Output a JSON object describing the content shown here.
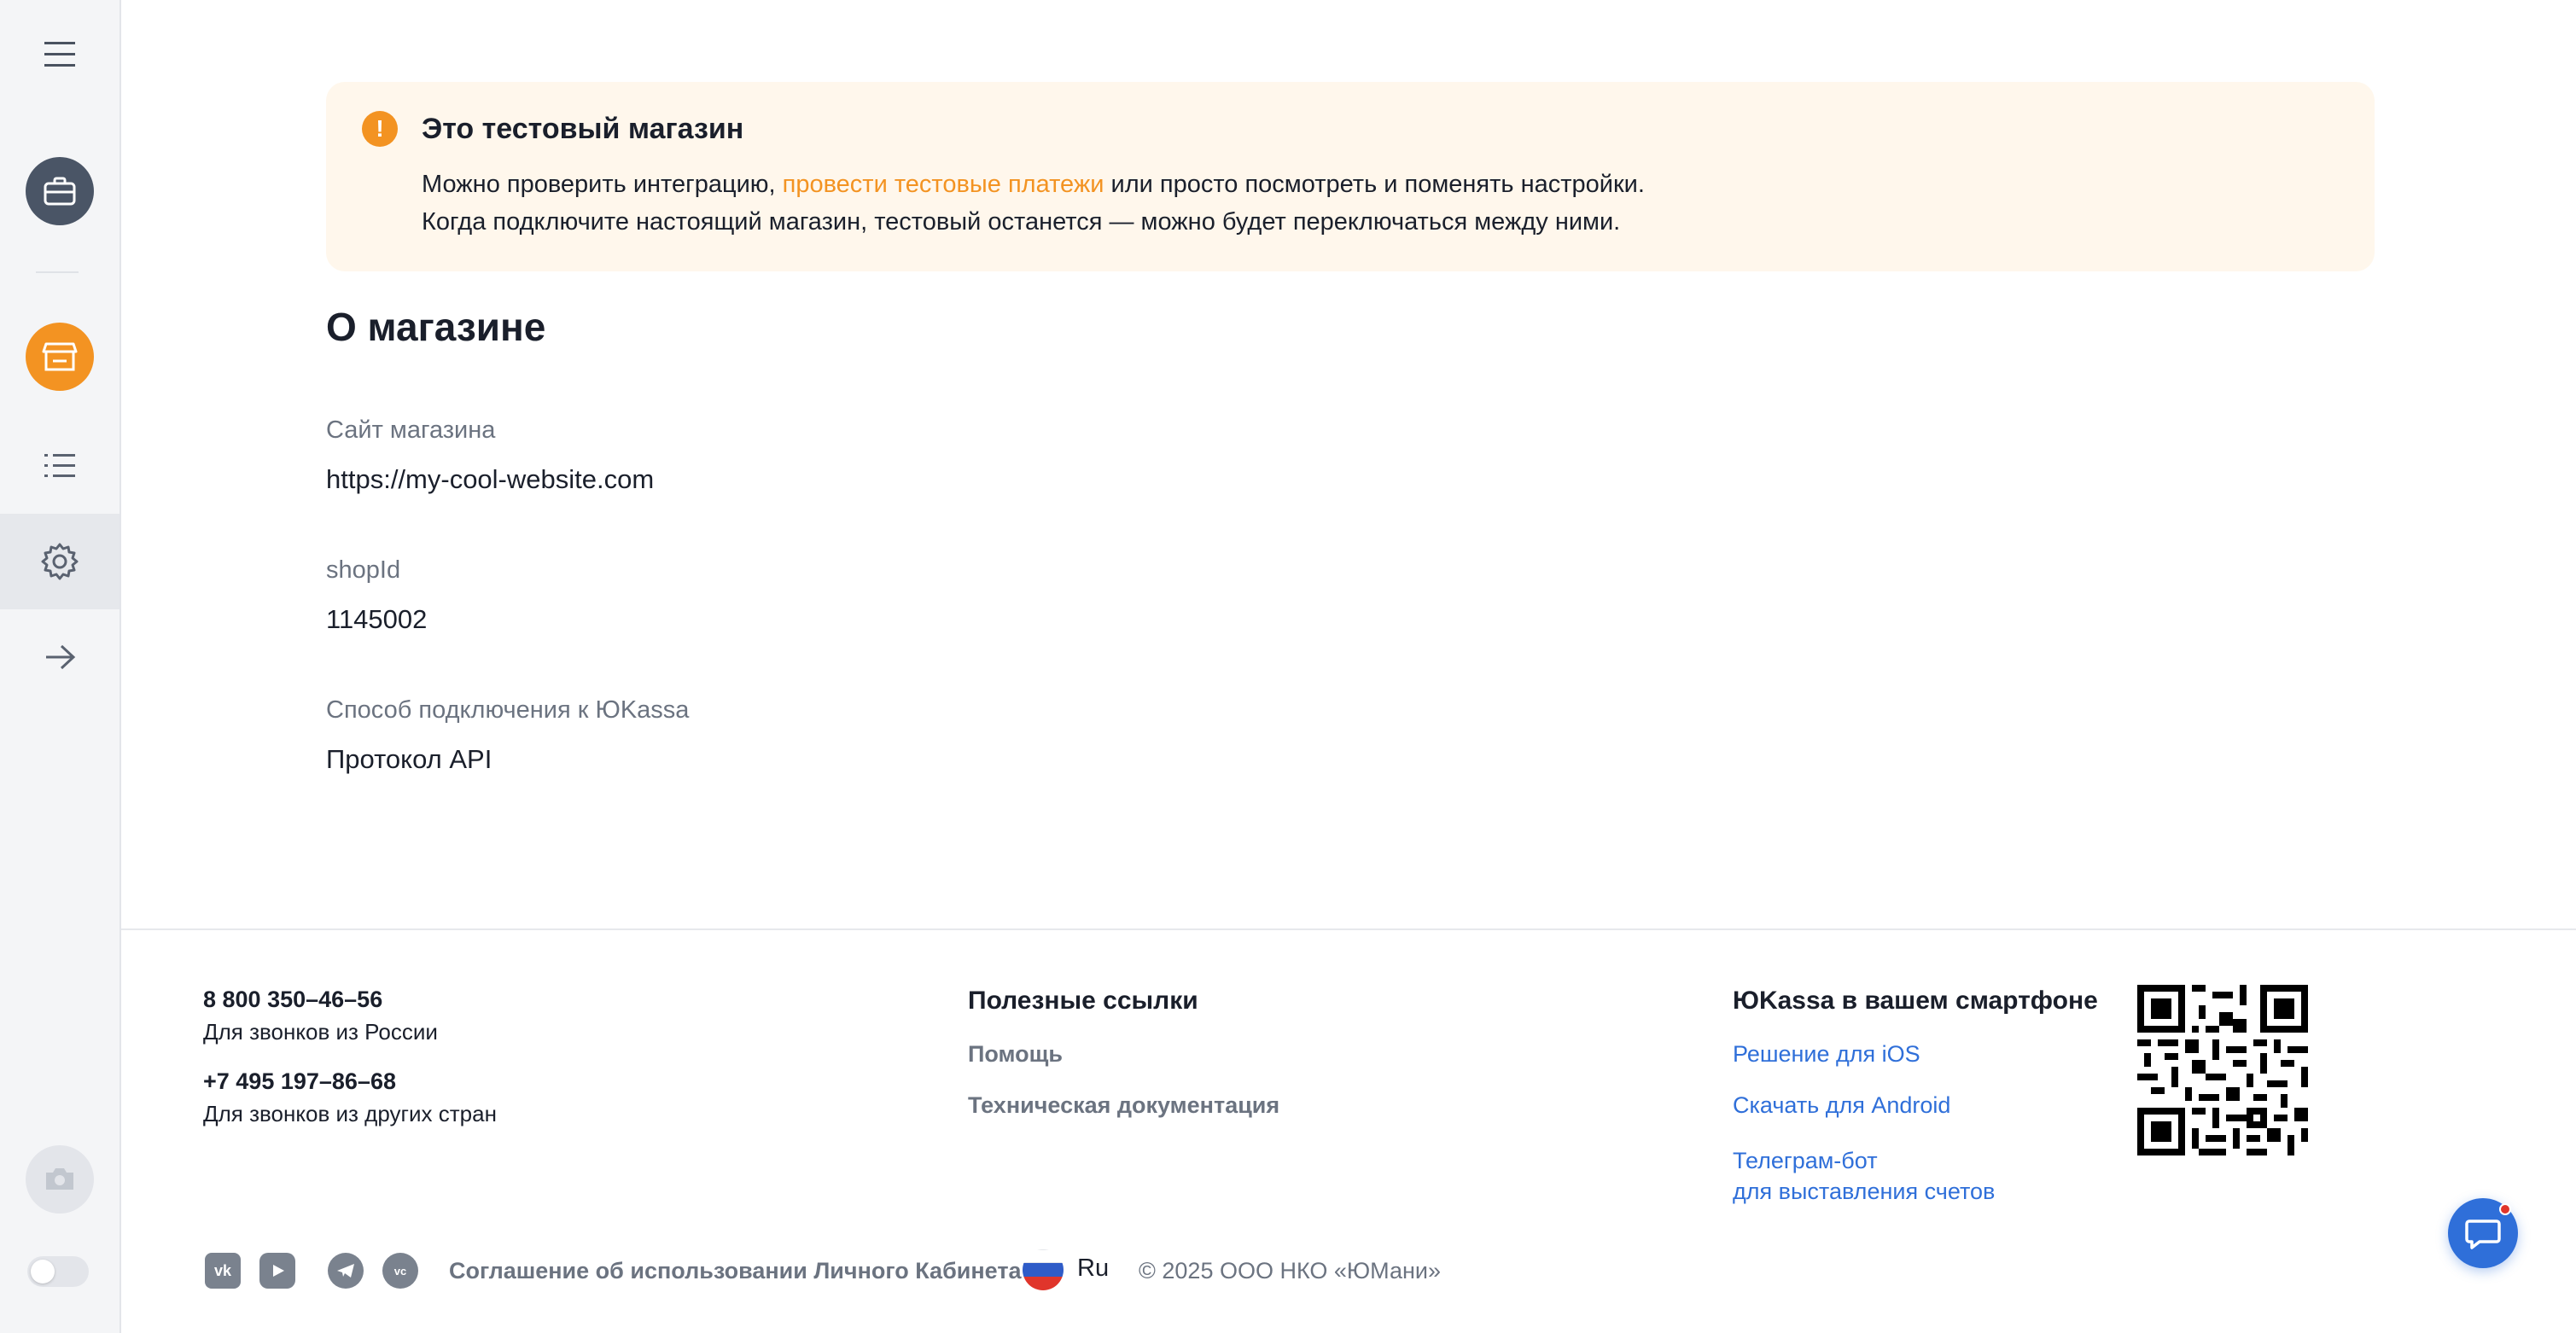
{
  "banner": {
    "title": "Это тестовый магазин",
    "line1_before": "Можно проверить интеграцию, ",
    "line1_link": "провести тестовые платежи",
    "line1_after": " или просто посмотреть и поменять настройки.",
    "line2": "Когда подключите настоящий магазин, тестовый останется — можно будет переключаться между ними."
  },
  "section": {
    "title": "О магазине",
    "fields": [
      {
        "label": "Сайт магазина",
        "value": "https://my-cool-website.com"
      },
      {
        "label": "shopId",
        "value": "1145002"
      },
      {
        "label": "Способ подключения к ЮKassa",
        "value": "Протокол API"
      }
    ]
  },
  "footer": {
    "phone1": "8 800 350–46–56",
    "phone1_note": "Для звонков из России",
    "phone2": "+7 495 197–86–68",
    "phone2_note": "Для звонков из других стран",
    "useful_title": "Полезные ссылки",
    "help": "Помощь",
    "docs": "Техническая документация",
    "mobile_title": "ЮKassa в вашем смартфоне",
    "ios": "Решение для iOS",
    "android": "Скачать для Android",
    "telegram_line1": "Телеграм-бот",
    "telegram_line2": "для выставления счетов",
    "agreement": "Соглашение об использовании Личного Кабинета",
    "lang": "Ru",
    "copyright": "© 2025 ООО НКО «ЮМани»"
  },
  "icons": {
    "menu": "hamburger-menu-icon",
    "briefcase": "briefcase-icon",
    "store": "store-icon",
    "list": "list-icon",
    "settings": "gear-icon",
    "arrow": "arrow-right-icon",
    "camera": "camera-icon",
    "chat": "chat-icon"
  },
  "colors": {
    "accent_orange": "#f39322",
    "link_blue": "#2f6fd9",
    "banner_bg": "#fff7ec",
    "sidebar_bg": "#f4f5f7"
  }
}
